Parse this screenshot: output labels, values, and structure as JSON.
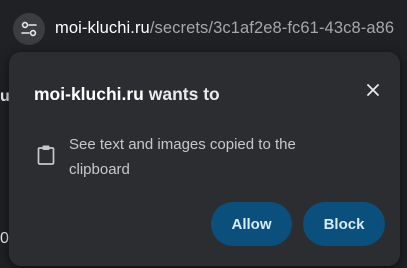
{
  "address_bar": {
    "host": "moi-kluchi.ru",
    "path": "/secrets/3c1af2e8-fc61-43c8-a86"
  },
  "background": {
    "glyph_top": "u",
    "glyph_bottom": "0"
  },
  "popup": {
    "origin": "moi-kluchi.ru",
    "title_suffix": " wants to",
    "permission_text": "See text and images copied to the clipboard",
    "allow_label": "Allow",
    "block_label": "Block"
  },
  "icons": {
    "site_info": "tune-icon",
    "close": "close-icon",
    "permission": "clipboard-icon"
  },
  "colors": {
    "popup_bg": "#2c2d30",
    "button_bg": "#0b4f7c",
    "button_text": "#d6ebff"
  }
}
